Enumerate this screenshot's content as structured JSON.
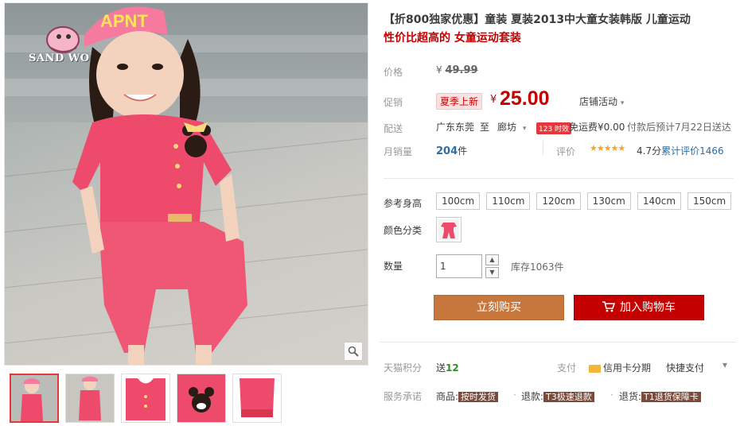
{
  "brand": {
    "logo_text": "SAND WORM",
    "cap_text": "APNT"
  },
  "product": {
    "title_main": "【折800独家优惠】童装 夏装2013中大童女装韩版 儿童运动",
    "title_sub": "性价比超高的 女童运动套装"
  },
  "price": {
    "label": "价格",
    "currency": "¥",
    "original": "49.99"
  },
  "promo": {
    "label": "促销",
    "tag": "夏季上新",
    "currency": "¥",
    "value": "25.00",
    "store_activity": "店铺活动"
  },
  "delivery": {
    "label": "配送",
    "from": "广东东莞",
    "to_word": "至",
    "to": "廊坊",
    "badge": "123 时效",
    "free_shipping": "免运费¥0.00",
    "eta": "付款后预计7月22日送达"
  },
  "sales": {
    "label": "月销量",
    "count": "204",
    "unit": "件",
    "review_label": "评价",
    "stars": "★★★★★",
    "rating": "4.7分",
    "review_count": "累计评价1466"
  },
  "options": {
    "size_label": "参考身高",
    "sizes": [
      "100cm",
      "110cm",
      "120cm",
      "130cm",
      "140cm",
      "150cm"
    ],
    "color_label": "颜色分类",
    "qty_label": "数量",
    "qty_value": "1",
    "stock": "库存1063件"
  },
  "actions": {
    "buy_now": "立刻购买",
    "add_to_cart": "加入购物车"
  },
  "points": {
    "label": "天猫积分",
    "give_text": "送",
    "value": "12",
    "pay_label": "支付",
    "credit": "信用卡分期",
    "quick_pay": "快捷支付"
  },
  "service": {
    "label": "服务承诺",
    "goods_label": "商品:",
    "goods_tag": "按时发货",
    "refund_label": "退款:",
    "refund_tag": "T3极速退款",
    "return_label": "退货:",
    "return_tag": "T1退货保障卡"
  },
  "colors": {
    "price_red": "#c40000",
    "buy_orange": "#c8773c",
    "cart_red": "#c40000",
    "link_blue": "#2b6ea7"
  }
}
